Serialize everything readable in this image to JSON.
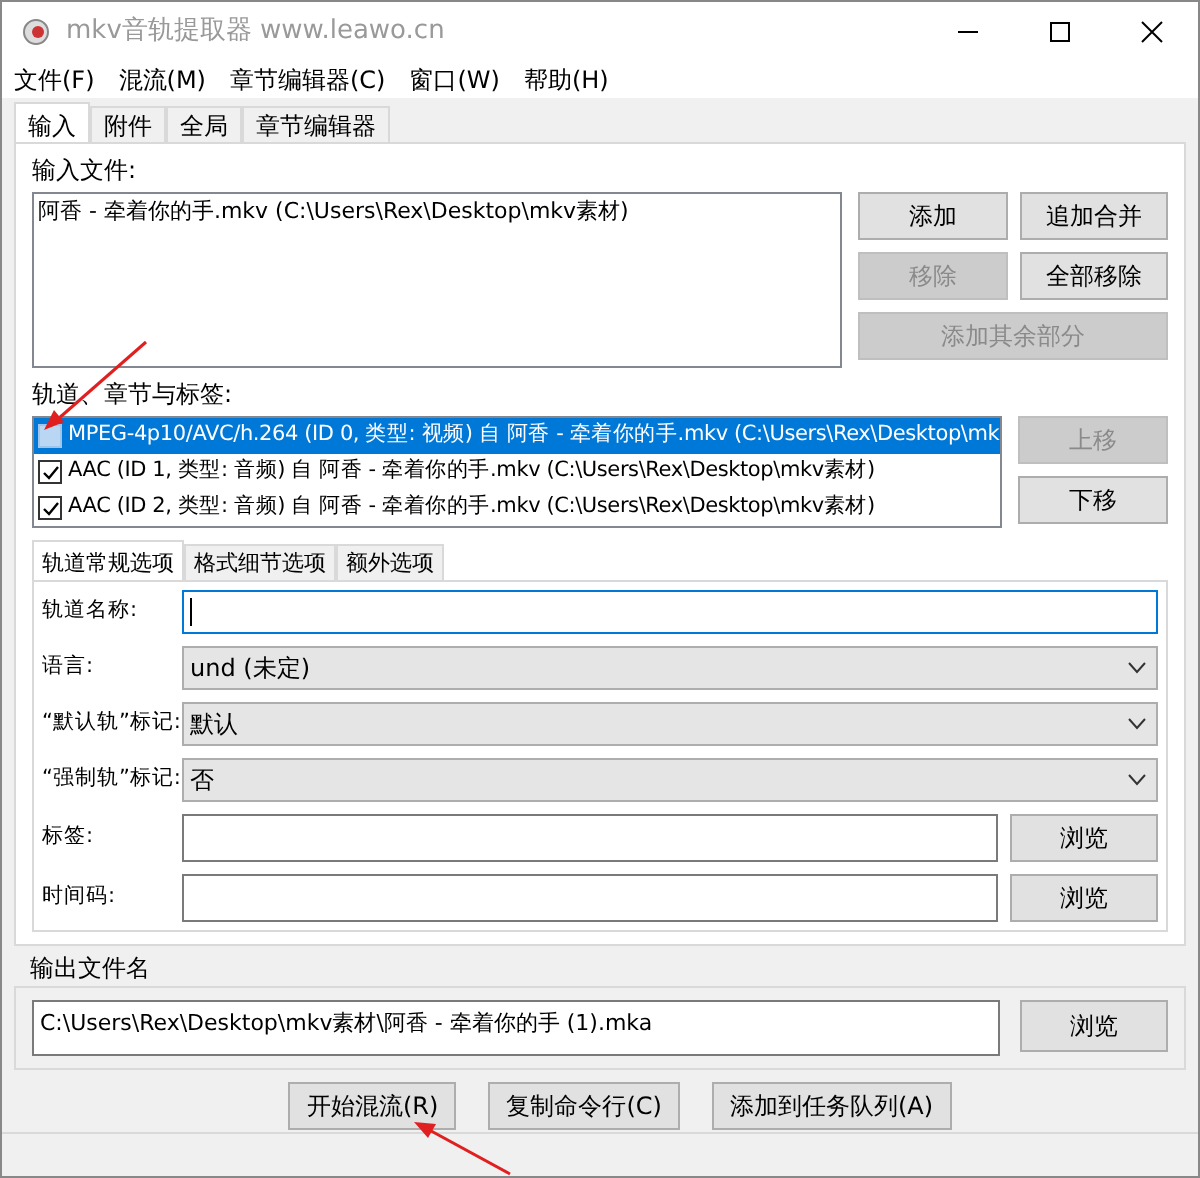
{
  "window": {
    "title": "mkv音轨提取器 www.leawo.cn"
  },
  "menu": [
    "文件(F)",
    "混流(M)",
    "章节编辑器(C)",
    "窗口(W)",
    "帮助(H)"
  ],
  "tabs": [
    {
      "label": "输入",
      "selected": true
    },
    {
      "label": "附件",
      "selected": false
    },
    {
      "label": "全局",
      "selected": false
    },
    {
      "label": "章节编辑器",
      "selected": false
    }
  ],
  "input_files": {
    "label": "输入文件:",
    "items": [
      "阿香 - 牵着你的手.mkv (C:\\Users\\Rex\\Desktop\\mkv素材)"
    ],
    "buttons": [
      {
        "label": "添加",
        "disabled": false
      },
      {
        "label": "追加合并",
        "disabled": false
      },
      {
        "label": "移除",
        "disabled": true
      },
      {
        "label": "全部移除",
        "disabled": false
      },
      {
        "label": "添加其余部分",
        "disabled": true
      }
    ]
  },
  "tracks": {
    "label": "轨道、章节与标签:",
    "items": [
      {
        "text": "MPEG-4p10/AVC/h.264 (ID 0, 类型: 视频) 自 阿香 - 牵着你的手.mkv (C:\\Users\\Rex\\Desktop\\mk",
        "checked": false,
        "selected": true
      },
      {
        "text": "AAC (ID 1, 类型: 音频) 自 阿香 - 牵着你的手.mkv (C:\\Users\\Rex\\Desktop\\mkv素材)",
        "checked": true,
        "selected": false
      },
      {
        "text": "AAC (ID 2, 类型: 音频) 自 阿香 - 牵着你的手.mkv (C:\\Users\\Rex\\Desktop\\mkv素材)",
        "checked": true,
        "selected": false
      }
    ],
    "buttons": [
      {
        "label": "上移",
        "disabled": true
      },
      {
        "label": "下移",
        "disabled": false
      }
    ]
  },
  "track_tabs": [
    {
      "label": "轨道常规选项",
      "selected": true
    },
    {
      "label": "格式细节选项",
      "selected": false
    },
    {
      "label": "额外选项",
      "selected": false
    }
  ],
  "track_fields": [
    {
      "kind": "text",
      "label": "轨道名称:",
      "focused": true
    },
    {
      "kind": "select",
      "label": "语言:",
      "value": "und (未定)"
    },
    {
      "kind": "select",
      "label": "“默认轨”标记:",
      "value": "默认"
    },
    {
      "kind": "select",
      "label": "“强制轨”标记:",
      "value": "否"
    },
    {
      "kind": "file",
      "label": "标签:",
      "button": "浏览"
    },
    {
      "kind": "file",
      "label": "时间码:",
      "button": "浏览"
    }
  ],
  "output": {
    "label": "输出文件名",
    "value": "C:\\Users\\Rex\\Desktop\\mkv素材\\阿香 - 牵着你的手 (1).mka",
    "button": "浏览"
  },
  "actions": [
    "开始混流(R)",
    "复制命令行(C)",
    "添加到任务队列(A)"
  ]
}
